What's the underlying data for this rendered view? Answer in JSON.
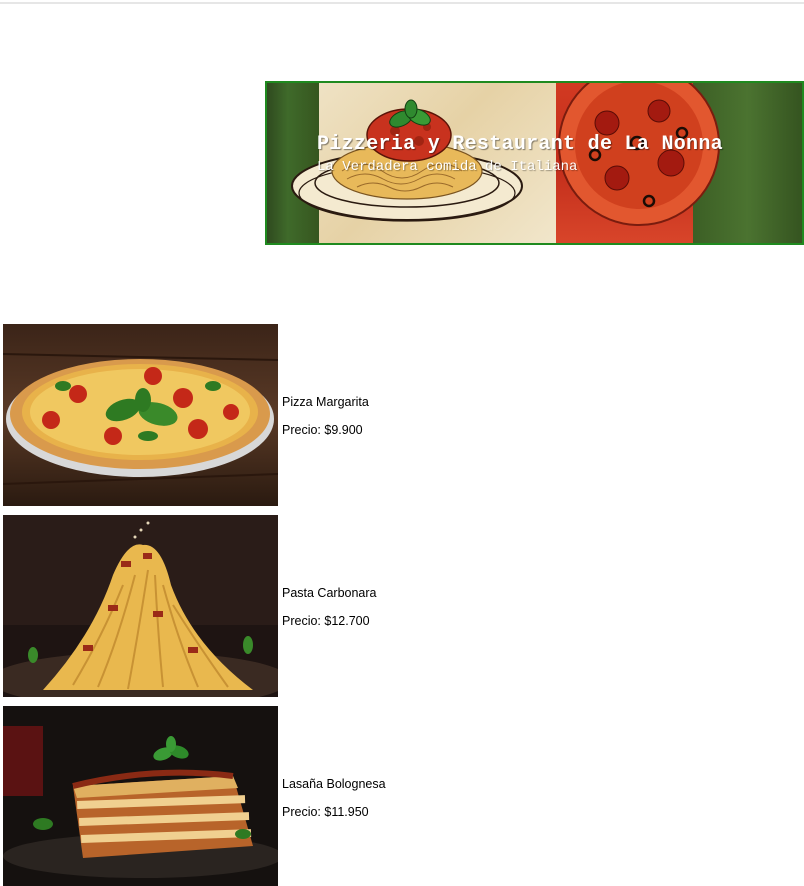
{
  "banner": {
    "title": "Pizzeria y Restaurant de La Nonna",
    "subtitle": "La Verdadera comida de Italiana"
  },
  "menu": {
    "items": [
      {
        "name": "Pizza Margarita",
        "price": "Precio: $9.900",
        "photo_icon": "pizza-photo"
      },
      {
        "name": "Pasta Carbonara",
        "price": "Precio: $12.700",
        "photo_icon": "pasta-photo"
      },
      {
        "name": "Lasaña Bolognesa",
        "price": "Precio: $11.950",
        "photo_icon": "lasagna-photo"
      }
    ]
  },
  "colors": {
    "banner_border": "#1f8a1f",
    "flag_green": "#3f6a2a",
    "flag_cream": "#efe2c4",
    "flag_red": "#c22d1a"
  }
}
